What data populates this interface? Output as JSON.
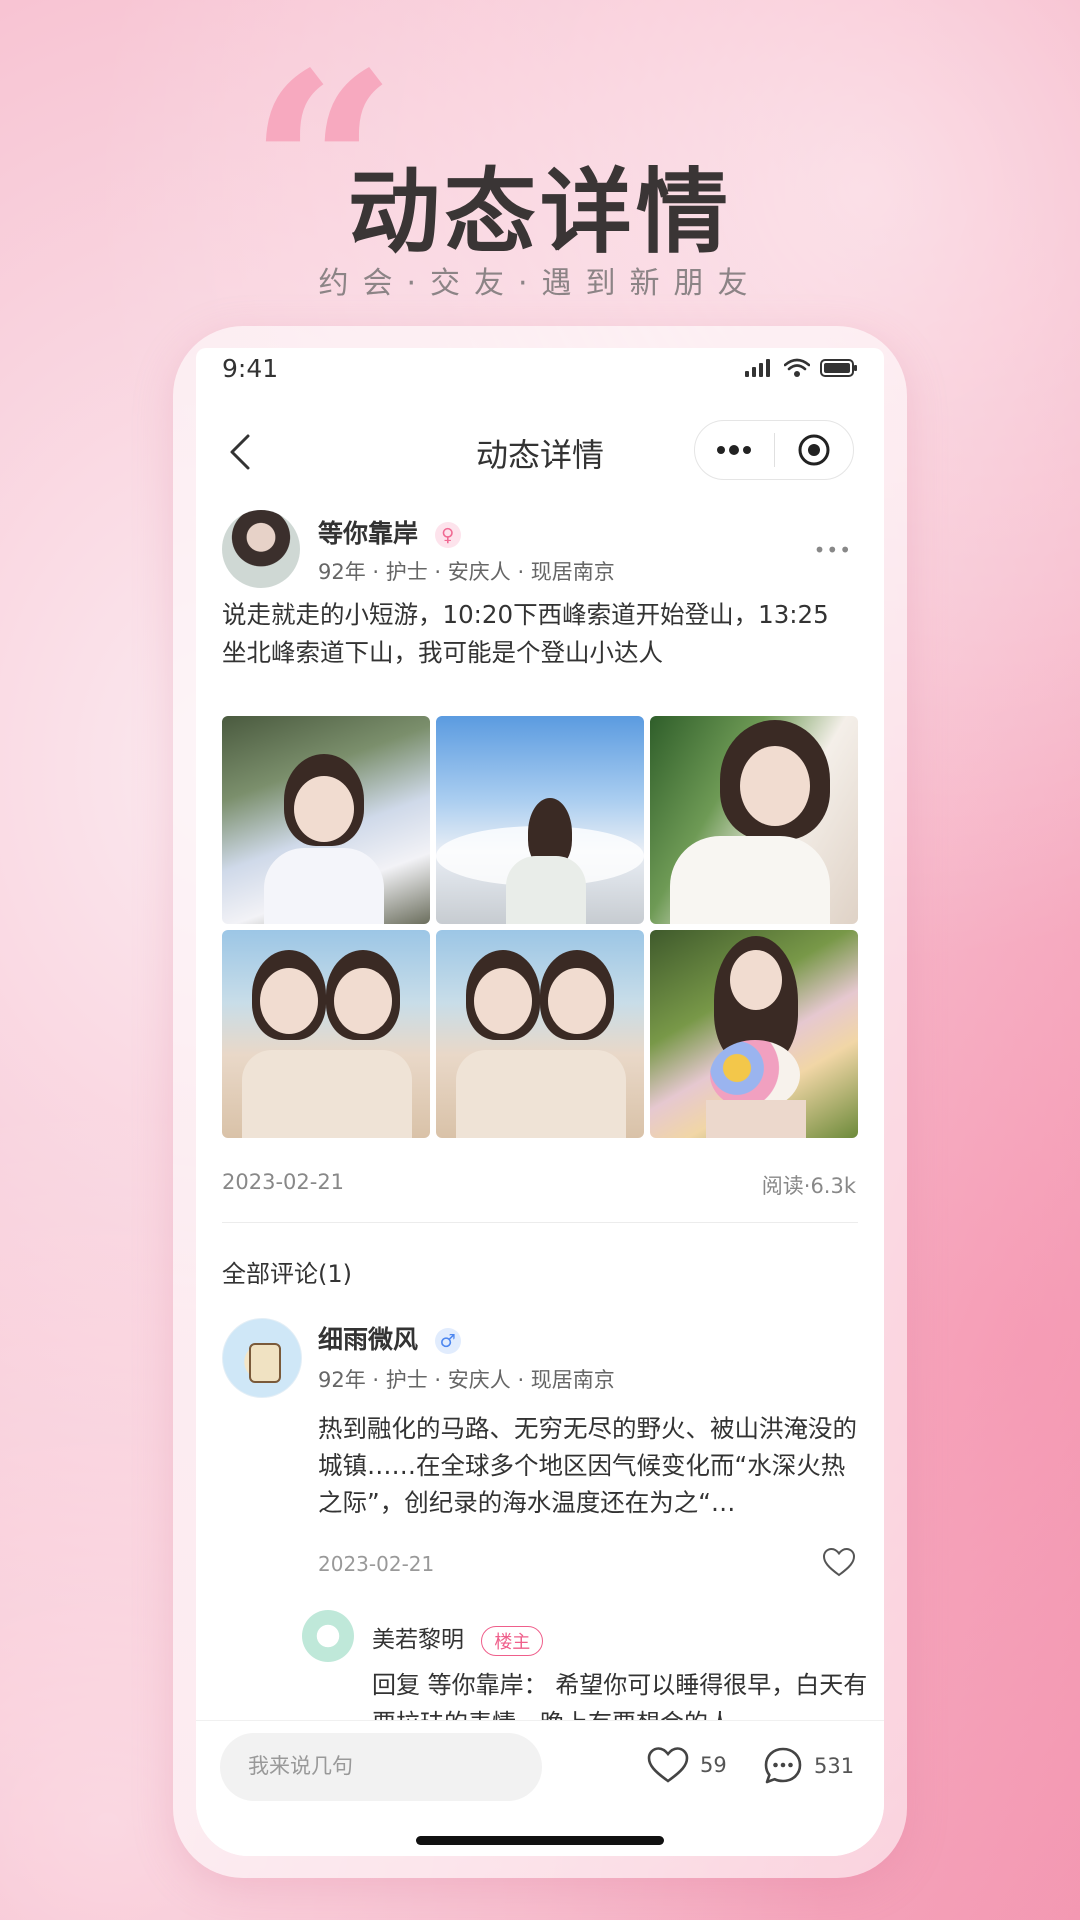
{
  "hero": {
    "quote_mark": "“",
    "title": "动态详情",
    "subtitle": "约会·交友·遇到新朋友"
  },
  "status_bar": {
    "time": "9:41",
    "icons": [
      "signal-icon",
      "wifi-icon",
      "battery-icon"
    ]
  },
  "nav": {
    "title": "动态详情",
    "back_icon": "chevron-left-icon",
    "more_icon": "more-dots-icon",
    "target_icon": "target-icon"
  },
  "post": {
    "author": {
      "name": "等你靠岸",
      "gender_symbol": "♀",
      "meta": "92年 · 护士 · 安庆人 · 现居南京"
    },
    "more_label": "•••",
    "text": "说走就走的小短游，10:20下西峰索道开始登山，13:25坐北峰索道下山，我可能是个登山小达人",
    "photo_count": 6,
    "date": "2023-02-21",
    "read_count": "阅读·6.3k"
  },
  "comments": {
    "header": "全部评论(1)",
    "items": [
      {
        "name": "细雨微风",
        "gender_symbol": "♂",
        "meta": "92年 · 护士 · 安庆人 · 现居南京",
        "text": "热到融化的马路、无穷无尽的野火、被山洪淹没的城镇……在全球多个地区因气候变化而“水深火热之际”，创纪录的海水温度还在为之“…",
        "date": "2023-02-21"
      }
    ],
    "reply": {
      "name": "美若黎明",
      "tag": "楼主",
      "text": "回复 等你靠岸： 希望你可以睡得很早，白天有要拉珐的表情，晚上有要想会的人"
    }
  },
  "bottom_bar": {
    "input_placeholder": "我来说几句",
    "like_count": "59",
    "comment_count": "531"
  },
  "colors": {
    "accent_pink": "#ef5f8b",
    "male_blue": "#4c86ef",
    "title_dark": "#3a3535"
  }
}
